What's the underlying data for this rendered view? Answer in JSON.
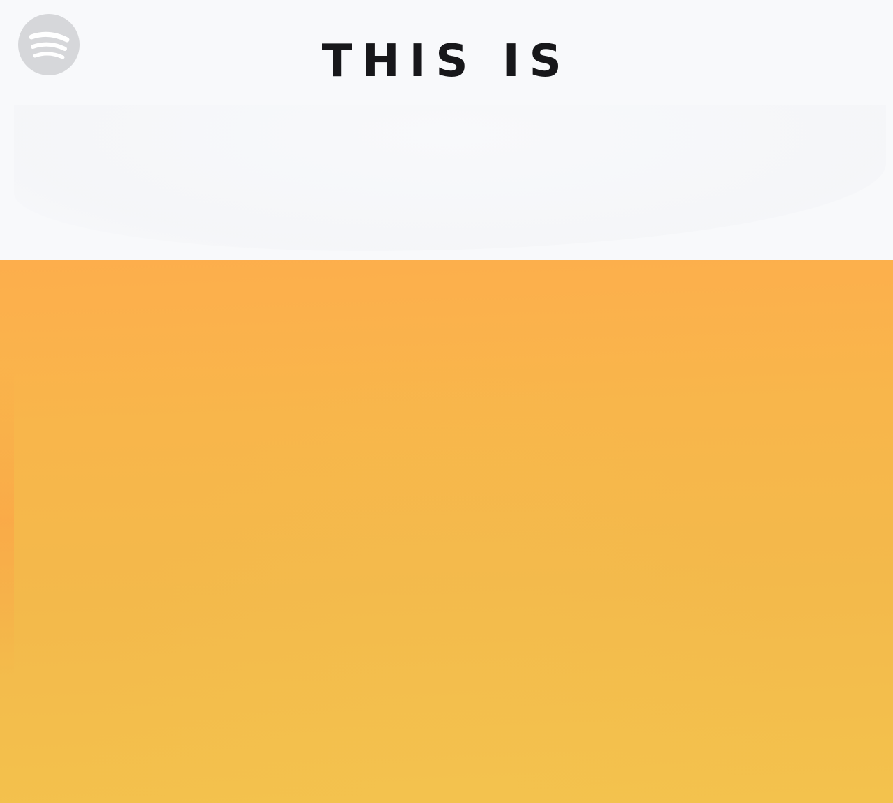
{
  "cover": {
    "title": "THIS IS",
    "logo_icon": "spotify-logo-icon",
    "colors": {
      "top_background": "#f8f9fb",
      "title_text": "#17171a",
      "logo_badge": "#d6d7da",
      "gradient_top": "#fdae4c",
      "gradient_bottom": "#f3c24d"
    }
  }
}
